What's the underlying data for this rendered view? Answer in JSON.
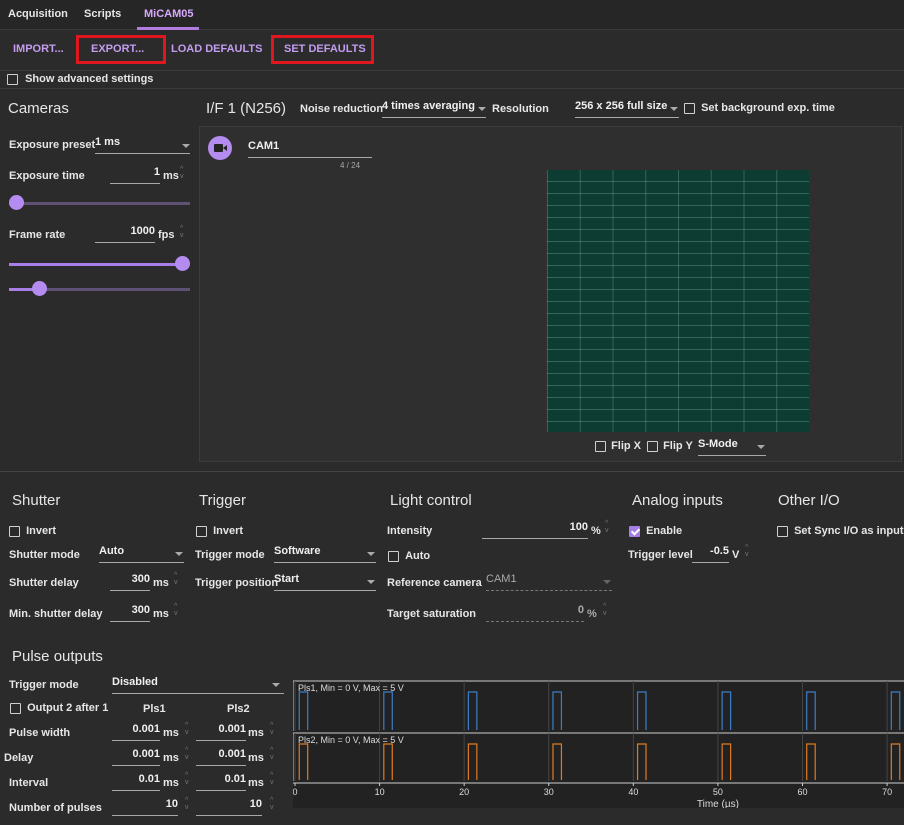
{
  "tabs": [
    {
      "label": "Acquisition"
    },
    {
      "label": "Scripts"
    },
    {
      "label": "MiCAM05"
    }
  ],
  "toolbar": {
    "import": "IMPORT...",
    "export": "EXPORT...",
    "load_defaults": "LOAD DEFAULTS",
    "set_defaults": "SET DEFAULTS"
  },
  "advanced": {
    "label": "Show advanced settings"
  },
  "cameras": {
    "title": "Cameras",
    "exposure_preset_label": "Exposure preset",
    "exposure_preset_value": "1 ms",
    "exposure_time_label": "Exposure time",
    "exposure_time_value": "1",
    "exposure_time_unit": "ms",
    "frame_rate_label": "Frame rate",
    "frame_rate_value": "1000",
    "frame_rate_unit": "fps",
    "exposure_slider_level": 0.0,
    "frame_rate_slider_level": 1.0,
    "second_slider_level": 0.14
  },
  "interface": {
    "title": "I/F 1 (N256)",
    "noise_label": "Noise reduction",
    "noise_value": "4 times averaging",
    "resolution_label": "Resolution",
    "resolution_value": "256 x 256 full size",
    "bg_label": "Set background exp. time",
    "camera_name": "CAM1",
    "camera_counter": "4 / 24",
    "flip_x": "Flip X",
    "flip_y": "Flip Y",
    "mode_value": "S-Mode"
  },
  "shutter": {
    "title": "Shutter",
    "invert": "Invert",
    "mode_label": "Shutter mode",
    "mode_value": "Auto",
    "delay_label": "Shutter delay",
    "delay_value": "300",
    "delay_unit": "ms",
    "min_label": "Min. shutter delay",
    "min_value": "300",
    "min_unit": "ms"
  },
  "trigger": {
    "title": "Trigger",
    "invert": "Invert",
    "mode_label": "Trigger mode",
    "mode_value": "Software",
    "position_label": "Trigger position",
    "position_value": "Start"
  },
  "light": {
    "title": "Light control",
    "intensity_label": "Intensity",
    "intensity_value": "100",
    "intensity_unit": "%",
    "auto": "Auto",
    "ref_label": "Reference camera",
    "ref_value": "CAM1",
    "sat_label": "Target saturation",
    "sat_value": "0",
    "sat_unit": "%"
  },
  "analog": {
    "title": "Analog inputs",
    "enable": "Enable",
    "level_label": "Trigger level",
    "level_value": "-0.5",
    "level_unit": "V"
  },
  "other": {
    "title": "Other I/O",
    "sync": "Set Sync I/O as input"
  },
  "pulse": {
    "title": "Pulse outputs",
    "trigger_label": "Trigger mode",
    "trigger_value": "Disabled",
    "output2": "Output 2 after 1",
    "col1": "Pls1",
    "col2": "Pls2",
    "rows": [
      {
        "label": "Pulse width",
        "v1": "0.001",
        "u1": "ms",
        "v2": "0.001",
        "u2": "ms"
      },
      {
        "label": "Delay",
        "v1": "0.001",
        "u1": "ms",
        "v2": "0.001",
        "u2": "ms"
      },
      {
        "label": "Interval",
        "v1": "0.01",
        "u1": "ms",
        "v2": "0.01",
        "u2": "ms"
      },
      {
        "label": "Number of pulses",
        "v1": "10",
        "u1": "",
        "v2": "10",
        "u2": ""
      }
    ]
  },
  "chart_data": {
    "type": "line",
    "xlabel": "Time (µs)",
    "x_ticks": [
      "0",
      "10",
      "20",
      "30",
      "40",
      "50",
      "60",
      "70"
    ],
    "xlim": [
      0,
      72
    ],
    "series": [
      {
        "name": "Pls1, Min = 0 V, Max = 5 V",
        "color": "#3d7fc6",
        "pulse_starts": [
          0.5,
          10.5,
          20.5,
          30.5,
          40.5,
          50.5,
          60.5,
          70.5
        ],
        "pulse_width": 1
      },
      {
        "name": "Pls2, Min = 0 V, Max = 5 V",
        "color": "#e07b24",
        "pulse_starts": [
          0.5,
          10.5,
          20.5,
          30.5,
          40.5,
          50.5,
          60.5,
          70.5
        ],
        "pulse_width": 1
      }
    ]
  }
}
